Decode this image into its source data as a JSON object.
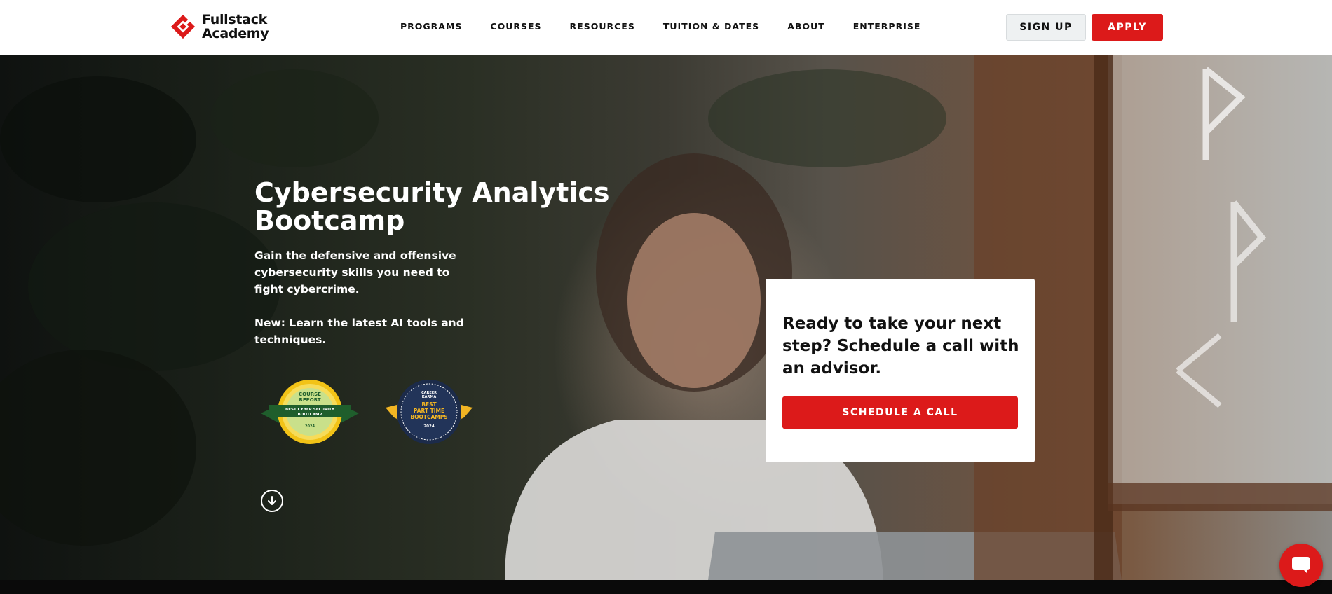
{
  "brand": {
    "name_line1": "Fullstack",
    "name_line2": "Academy",
    "color": "#dc1a1a"
  },
  "nav": {
    "items": [
      {
        "label": "PROGRAMS"
      },
      {
        "label": "COURSES"
      },
      {
        "label": "RESOURCES"
      },
      {
        "label": "TUITION & DATES"
      },
      {
        "label": "ABOUT"
      },
      {
        "label": "ENTERPRISE"
      }
    ],
    "signup_label": "SIGN UP",
    "apply_label": "APPLY"
  },
  "hero": {
    "title": "Cybersecurity Analytics Bootcamp",
    "description": "Gain the defensive and offensive cybersecurity skills you need to fight cybercrime.",
    "new_note": "New: Learn the latest AI tools and techniques.",
    "badges": [
      {
        "line1": "COURSE",
        "line2": "REPORT",
        "line3": "BEST CYBER SECURITY",
        "line4": "BOOTCAMP",
        "year": "2024",
        "icon": "course-report-badge"
      },
      {
        "line1": "CAREER",
        "line2": "KARMA",
        "line3": "BEST",
        "line4": "PART TIME",
        "line5": "BOOTCAMPS",
        "year": "2024",
        "icon": "career-karma-badge"
      }
    ]
  },
  "cta": {
    "heading": "Ready to take your next step? Schedule a call with an advisor.",
    "button_label": "SCHEDULE A CALL"
  },
  "icons": {
    "scroll": "arrow-down-circle-icon",
    "chat": "chat-bubble-icon"
  }
}
